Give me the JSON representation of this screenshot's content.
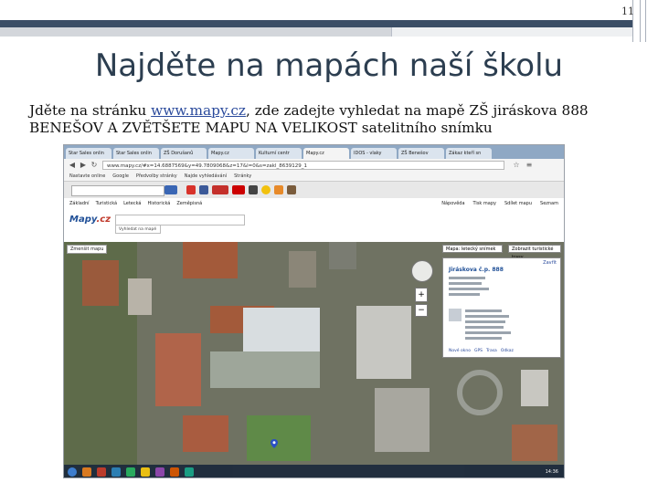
{
  "page_number": "11",
  "title": "Najděte na mapách naší školu",
  "body": {
    "prefix": "Jděte na stránku ",
    "link": "www.mapy.cz",
    "suffix": ", zde zadejte vyhledat na mapě ZŠ jiráskova 888 BENEŠOV A ZVĚTŠETE MAPU NA VELIKOST satelitního snímku"
  },
  "browser": {
    "tabs": [
      "Star Sales onlin",
      "Star Sales onlin",
      "ZŠ Dorušanů",
      "Mapy.cz",
      "Kulturní centr",
      "Mapy.cz",
      "IDOS - vlaky",
      "ZŠ Benešov",
      "Zákaz kteří sn"
    ],
    "address": "www.mapy.cz/#x=14.6887569&y=49.7809068&z=17&l=0&s=zakl_8639129_1",
    "bookmarks": [
      "Nastavte online",
      "Google",
      "Předvolby stránky",
      "Najde vyhledávání",
      "Stránky"
    ],
    "menu_left": [
      "Základní",
      "Turistická",
      "Letecká",
      "Historická",
      "Zeměpisná"
    ],
    "menu_right": [
      "Nápověda",
      "Tisk mapy",
      "Sdílet mapu",
      "Seznam"
    ],
    "logo_main": "Mapy",
    "logo_accent": ".cz",
    "search_button": "Vyhledat na mapě"
  },
  "map": {
    "zoom_label": "Zmenšit mapu",
    "type_select": "Mapa: letecký snímek",
    "layer_select": "Zobrazit turistické trasy",
    "panel": {
      "title": "Jiráskova č.p. 888",
      "close": "Zavřít",
      "links": [
        "Nové okno",
        "GPS",
        "Trasa",
        "Odkaz"
      ]
    },
    "clock": "14:36"
  }
}
